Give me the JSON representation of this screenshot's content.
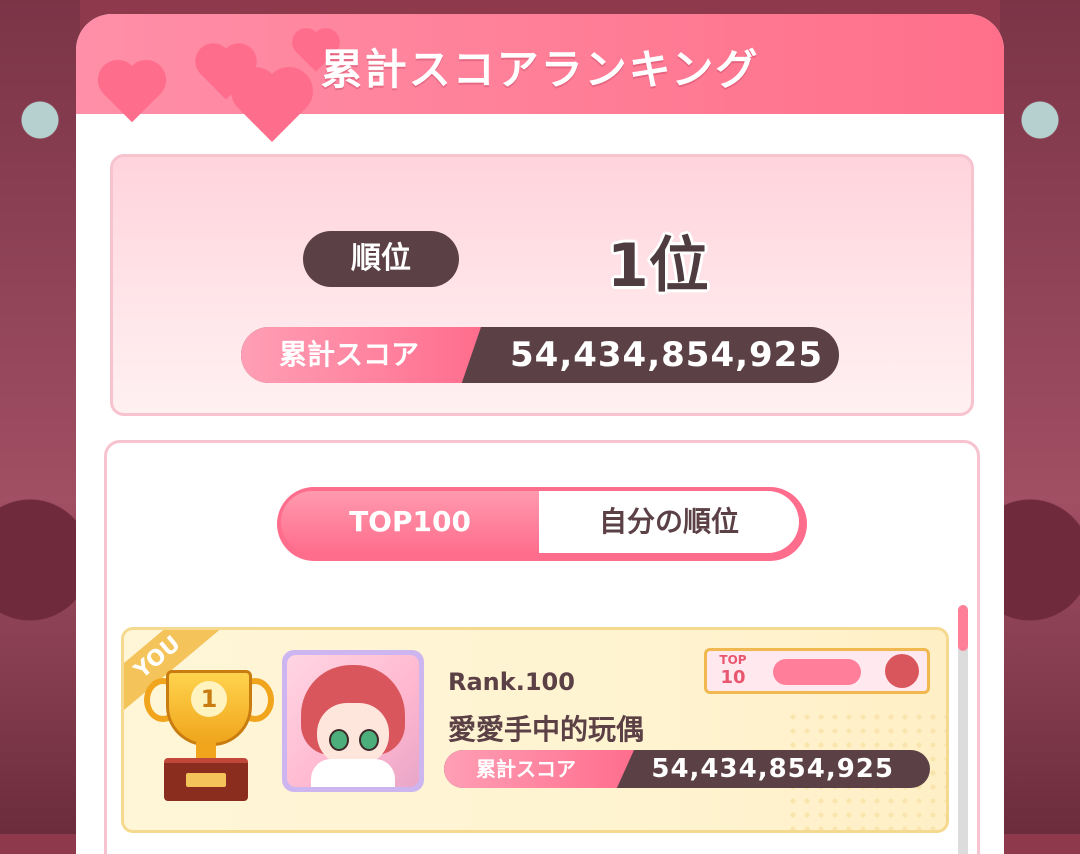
{
  "header": {
    "title": "累計スコアランキング"
  },
  "summary": {
    "rank_label": "順位",
    "rank_value": "1位",
    "score_label": "累計スコア",
    "score_value": "54,434,854,925"
  },
  "tabs": [
    {
      "label": "TOP100",
      "active": true
    },
    {
      "label": "自分の順位",
      "active": false
    }
  ],
  "entry": {
    "you_label": "YOU",
    "trophy_number": "1",
    "rank_text": "Rank.100",
    "player_name": "愛愛手中的玩偶",
    "badge": {
      "top_small": "TOP",
      "top_big": "10"
    },
    "score_label": "累計スコア",
    "score_value": "54,434,854,925"
  },
  "colors": {
    "accent_pink": "#ff6d8d",
    "dark_brown": "#5b4046",
    "gold": "#f0a51c"
  }
}
